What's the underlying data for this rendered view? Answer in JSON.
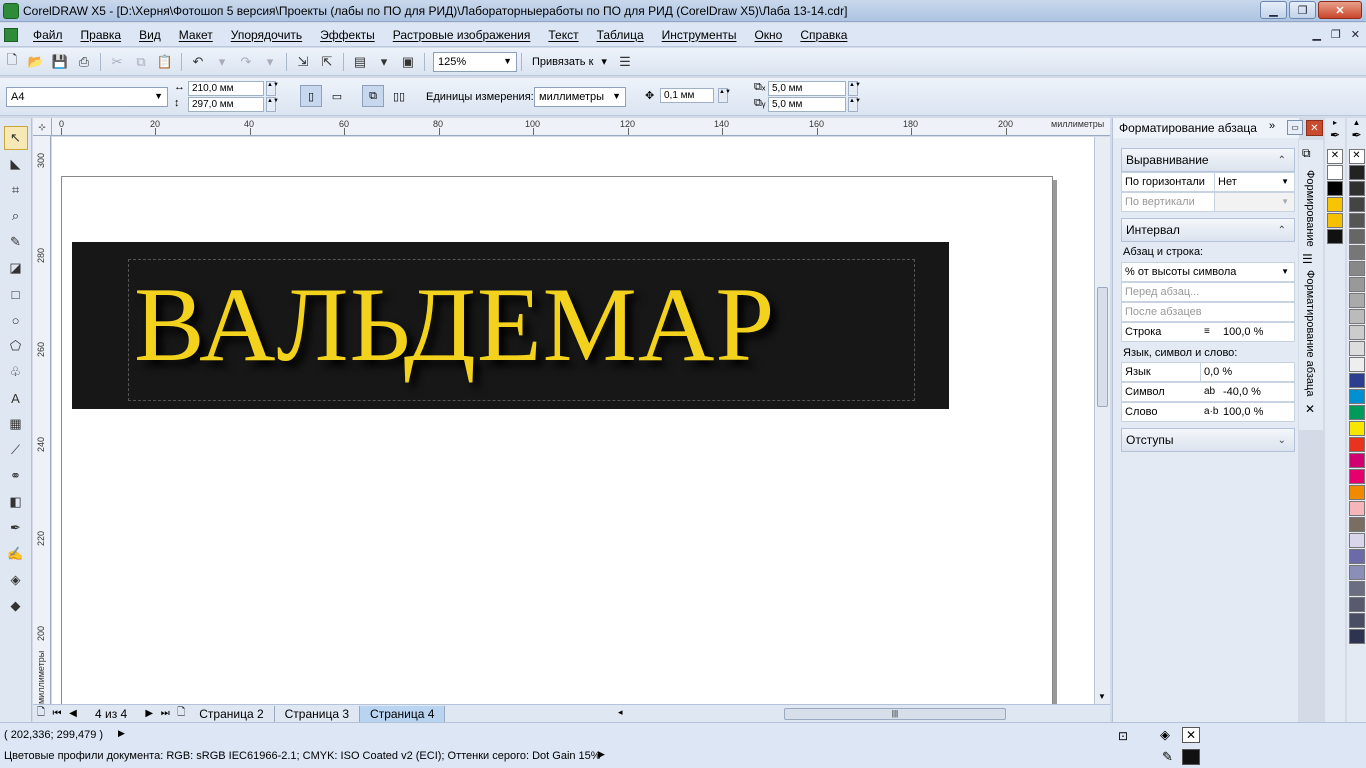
{
  "window": {
    "title": "CorelDRAW X5 - [D:\\Херня\\Фотошоп 5 версия\\Проекты (лабы по ПО для РИД)\\Лабораторныеработы по ПО для РИД (CorelDraw X5)\\Лаба 13-14.cdr]"
  },
  "menu": [
    "Файл",
    "Правка",
    "Вид",
    "Макет",
    "Упорядочить",
    "Эффекты",
    "Растровые изображения",
    "Текст",
    "Таблица",
    "Инструменты",
    "Окно",
    "Справка"
  ],
  "toolbar": {
    "zoom": "125%",
    "snap_label": "Привязать к"
  },
  "propertybar": {
    "paper": "A4",
    "width": "210,0 мм",
    "height": "297,0 мм",
    "units_label": "Единицы измерения:",
    "units_value": "миллиметры",
    "nudge": "0,1 мм",
    "dup_x": "5,0 мм",
    "dup_y": "5,0 мм"
  },
  "ruler": {
    "h_labels": [
      "0",
      "20",
      "40",
      "60",
      "80",
      "100",
      "120",
      "140",
      "160",
      "180",
      "200"
    ],
    "h_unit": "миллиметры",
    "v_labels": [
      "300",
      "280",
      "260",
      "240",
      "220",
      "200"
    ],
    "v_unit": "миллиметры"
  },
  "artwork": {
    "text": "ВАЛЬДЕМАР",
    "text_color": "#f2d21c",
    "background_color": "#161716"
  },
  "pages": {
    "counter": "4 из 4",
    "tabs": [
      "Страница 2",
      "Страница 3",
      "Страница 4"
    ],
    "active_tab": "Страница 4"
  },
  "docker": {
    "title": "Форматирование абзаца",
    "alignment": {
      "header": "Выравнивание",
      "horizontal_label": "По горизонтали",
      "horizontal_value": "Нет",
      "vertical_label": "По вертикали"
    },
    "spacing": {
      "header": "Интервал",
      "para_line_label": "Абзац и строка:",
      "para_line_mode": "% от высоты символа",
      "before_label": "Перед абзац...",
      "after_label": "После абзацев",
      "line_label": "Строка",
      "line_value": "100,0 %",
      "lang_header": "Язык, символ и слово:",
      "lang_label": "Язык",
      "lang_value": "0,0 %",
      "char_label": "Символ",
      "char_value": "-40,0 %",
      "word_label": "Слово",
      "word_value": "100,0 %"
    },
    "indents_header": "Отступы",
    "vtab_1": "Формирование",
    "vtab_2": "Форматирование абзаца"
  },
  "palette": [
    "#ffffff",
    "#000000",
    "#f6c400",
    "#f5c000",
    "#111111",
    "#222222",
    "#303030",
    "#444444",
    "#555555",
    "#666666",
    "#777777",
    "#888888",
    "#999999",
    "#aaaaaa",
    "#bbbbbb",
    "#cccccc",
    "#dddddd",
    "#eeeeee",
    "#2c3e90",
    "#0090d0",
    "#009a5a",
    "#f7e600",
    "#e8331f",
    "#d0006f",
    "#e5006d",
    "#f08a00",
    "#f4b6b8",
    "#7a6e62",
    "#d9d6ec",
    "#6c6aa8",
    "#8b8fb8",
    "#6b6e80",
    "#595a6e",
    "#4a4e65",
    "#2e3450"
  ],
  "status": {
    "coords": "( 202,336; 299,479 )",
    "profiles": "Цветовые профили документа: RGB: sRGB IEC61966-2.1; CMYK: ISO Coated v2 (ECI); Оттенки серого: Dot Gain 15%"
  }
}
